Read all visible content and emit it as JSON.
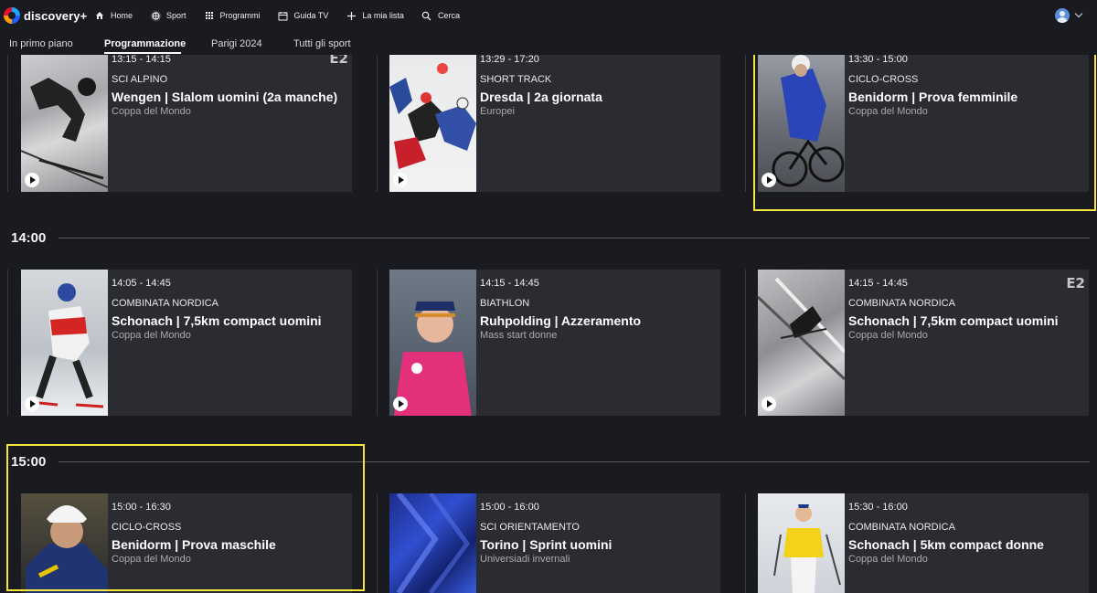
{
  "app": {
    "name": "discovery+"
  },
  "nav": [
    {
      "label": "Home",
      "icon": "home-icon"
    },
    {
      "label": "Sport",
      "icon": "sport-icon"
    },
    {
      "label": "Programmi",
      "icon": "grid-icon"
    },
    {
      "label": "Guida TV",
      "icon": "tv-guide-icon"
    },
    {
      "label": "La mia lista",
      "icon": "plus-icon"
    },
    {
      "label": "Cerca",
      "icon": "search-icon"
    }
  ],
  "tabs": [
    {
      "label": "In primo piano"
    },
    {
      "label": "Programmazione",
      "active": true
    },
    {
      "label": "Parigi 2024"
    },
    {
      "label": "Tutti gli sport"
    }
  ],
  "times": [
    "14:00",
    "15:00"
  ],
  "cards": [
    {
      "time": "13:15 - 14:15",
      "sport": "SCI ALPINO",
      "title": "Wengen | Slalom uomini (2a manche)",
      "sub": "Coppa del Mondo",
      "badge": "E2"
    },
    {
      "time": "13:29 - 17:20",
      "sport": "SHORT TRACK",
      "title": "Dresda | 2a giornata",
      "sub": "Europei",
      "badge": ""
    },
    {
      "time": "13:30 - 15:00",
      "sport": "CICLO-CROSS",
      "title": "Benidorm | Prova femminile",
      "sub": "Coppa del Mondo",
      "badge": ""
    },
    {
      "time": "14:05 - 14:45",
      "sport": "COMBINATA NORDICA",
      "title": "Schonach | 7,5km compact uomini",
      "sub": "Coppa del Mondo",
      "badge": ""
    },
    {
      "time": "14:15 - 14:45",
      "sport": "BIATHLON",
      "title": "Ruhpolding | Azzeramento",
      "sub": "Mass start donne",
      "badge": ""
    },
    {
      "time": "14:15 - 14:45",
      "sport": "COMBINATA NORDICA",
      "title": "Schonach | 7,5km compact uomini",
      "sub": "Coppa del Mondo",
      "badge": "E2"
    },
    {
      "time": "15:00 - 16:30",
      "sport": "CICLO-CROSS",
      "title": "Benidorm | Prova maschile",
      "sub": "Coppa del Mondo",
      "badge": ""
    },
    {
      "time": "15:00 - 16:00",
      "sport": "SCI ORIENTAMENTO",
      "title": "Torino | Sprint uomini",
      "sub": "Universiadi invernali",
      "badge": ""
    },
    {
      "time": "15:30 - 16:00",
      "sport": "COMBINATA NORDICA",
      "title": "Schonach | 5km compact donne",
      "sub": "Coppa del Mondo",
      "badge": ""
    }
  ],
  "colors": {
    "background": "#1a1b20",
    "card": "#2b2c31",
    "highlight": "#f3e63a",
    "muted_text": "#a9aab0"
  }
}
